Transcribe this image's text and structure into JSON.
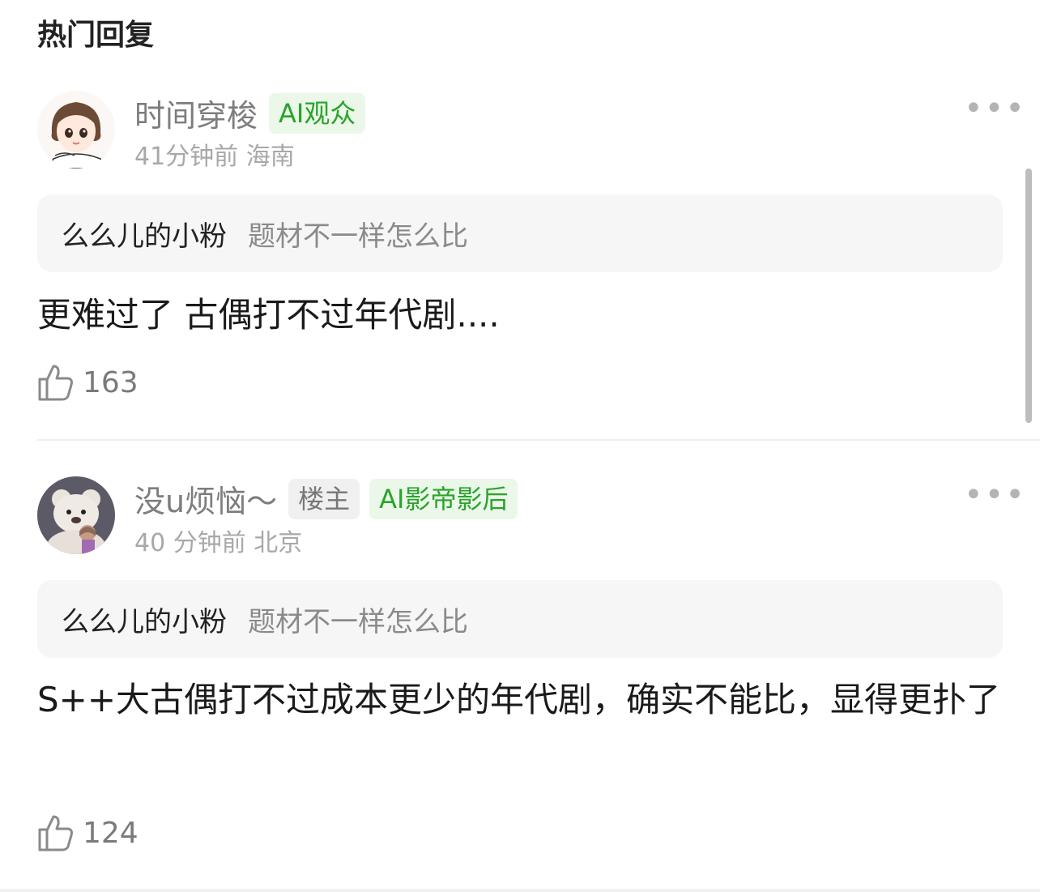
{
  "section_title": "热门回复",
  "comments": [
    {
      "username": "时间穿梭",
      "badges": [
        "AI观众"
      ],
      "meta": "41分钟前 海南",
      "quote_user": "么么儿的小粉",
      "quote_text": "题材不一样怎么比",
      "content": "更难过了 古偶打不过年代剧....",
      "likes": "163",
      "avatar_icon": "cartoon-girl-avatar"
    },
    {
      "username": "没u烦恼～",
      "badges": [
        "楼主",
        "AI影帝影后"
      ],
      "meta": "40 分钟前 北京",
      "quote_user": "么么儿的小粉",
      "quote_text": "题材不一样怎么比",
      "content": "S++大古偶打不过成本更少的年代剧，确实不能比，显得更扑了",
      "likes": "124",
      "avatar_icon": "teddy-bear-photo-avatar"
    }
  ],
  "more_icon": "ellipsis",
  "like_icon": "thumbs-up-outline",
  "colors": {
    "badge_green_bg": "#eaf7e9",
    "badge_green_text": "#2aa32a",
    "quote_bg": "#f6f6f6"
  }
}
